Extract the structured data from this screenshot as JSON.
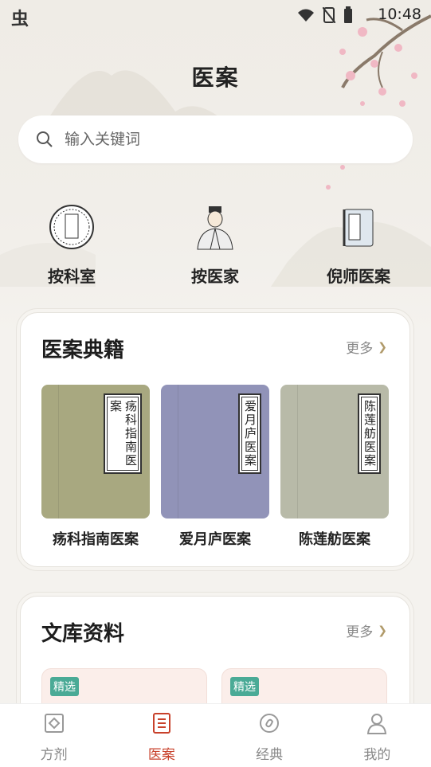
{
  "status": {
    "time": "10:48",
    "logo": "虫"
  },
  "header": {
    "title": "医案"
  },
  "search": {
    "placeholder": "输入关键词"
  },
  "categories": [
    {
      "label": "按科室",
      "icon": "department-seal-icon"
    },
    {
      "label": "按医家",
      "icon": "doctor-portrait-icon"
    },
    {
      "label": "倪师医案",
      "icon": "scroll-book-icon"
    }
  ],
  "classics": {
    "title": "医案典籍",
    "more": "更多",
    "books": [
      {
        "name": "疡科指南医案",
        "cover_cols": [
          "疡科指南医",
          "案"
        ],
        "color": "#a8a880"
      },
      {
        "name": "爱月庐医案",
        "cover_cols": [
          "爱月庐医案"
        ],
        "color": "#9193b8"
      },
      {
        "name": "陈莲舫医案",
        "cover_cols": [
          "陈莲舫医案"
        ],
        "color": "#b8baa8"
      }
    ]
  },
  "library": {
    "title": "文库资料",
    "more": "更多",
    "items": [
      {
        "tag": "精选"
      },
      {
        "tag": "精选"
      }
    ]
  },
  "tabs": [
    {
      "label": "方剂",
      "icon": "formula-icon",
      "active": false
    },
    {
      "label": "医案",
      "icon": "case-record-icon",
      "active": true
    },
    {
      "label": "经典",
      "icon": "classic-icon",
      "active": false
    },
    {
      "label": "我的",
      "icon": "profile-icon",
      "active": false
    }
  ],
  "colors": {
    "accent": "#c8412b",
    "tag": "#4aaa96"
  }
}
